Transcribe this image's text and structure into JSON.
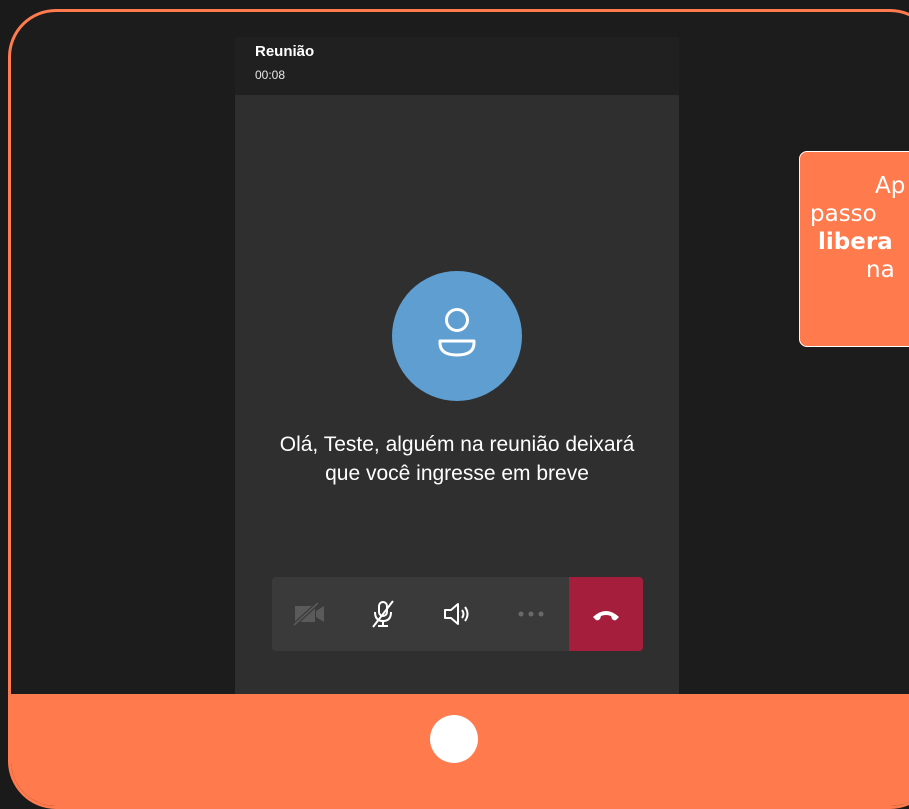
{
  "meeting": {
    "title": "Reunião",
    "timer": "00:08",
    "message": "Olá, Teste, alguém na reunião deixará que você ingresse em breve"
  },
  "controls": [
    {
      "name": "camera-off",
      "icon": "video-off-icon"
    },
    {
      "name": "mic-off",
      "icon": "mic-off-icon"
    },
    {
      "name": "speaker",
      "icon": "speaker-icon"
    },
    {
      "name": "more",
      "icon": "more-options-icon"
    },
    {
      "name": "hang-up",
      "icon": "phone-hangup-icon"
    }
  ],
  "callout": {
    "line1": "Ap",
    "line2": "passo",
    "line3": "libera",
    "line4": "na"
  },
  "colors": {
    "frame": "#ff7a4d",
    "hangup": "#a51e3c",
    "avatar": "#5f9ed1",
    "background": "#1a1a1a"
  }
}
